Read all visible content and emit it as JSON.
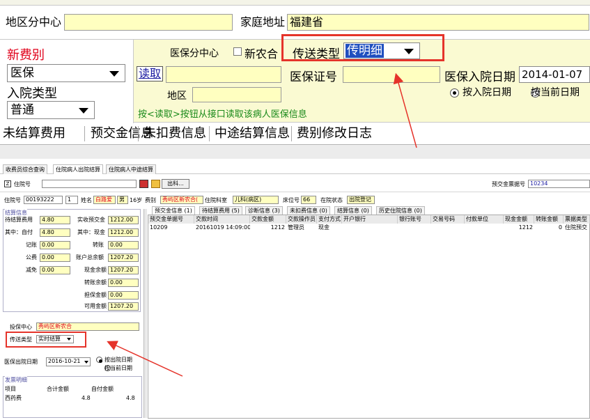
{
  "top": {
    "district_label": "地区分中心",
    "home_address_label": "家庭地址",
    "home_address_value": "福建省",
    "new_fee_type_label": "新费别",
    "fee_type_value": "医保",
    "admission_type_label": "入院类型",
    "admission_type_value": "普通",
    "insurance_center_label": "医保分中心",
    "new_rural_label": "新农合",
    "transfer_type_label": "传送类型",
    "transfer_type_value": "传明细",
    "read_card_button": "读取",
    "insurance_id_label": "医保证号",
    "admission_date_label": "医保入院日期",
    "admission_date_value": "2014-01-07",
    "area_label": "地区",
    "by_admission_date": "按入院日期",
    "by_current_date": "按当前日期",
    "read_hint": "按<读取>按钮从接口读取该病人医保信息",
    "tabs": [
      "未结算费用",
      "预交金信息",
      "未扣费信息",
      "中途结算信息",
      "费别修改日志"
    ]
  },
  "bottom": {
    "window_tabs": [
      "收费员综合查询",
      "住院病人出院结算",
      "住院病人中途结算"
    ],
    "inpatient_no_label": "住院号",
    "exit_button": "出科...",
    "prepay_receipt_label": "预交金票据号",
    "prepay_receipt_value": "10234",
    "info": {
      "inpatient_no_label": "住院号",
      "inpatient_no": "00193222",
      "visit_count": "1",
      "name_label": "姓名",
      "name": "白路爱",
      "gender": "男",
      "age": "16岁",
      "fee_label": "费别",
      "fee_value": "秀屿区新农合(",
      "dept_label": "住院科室",
      "dept_value": "儿科(病区)",
      "bed_label": "床位号",
      "bed_value": "66",
      "status_label": "在院状态",
      "status_value": "出院登记"
    },
    "settle": {
      "group_title": "结算信息",
      "pending_fee_label": "待结算费用",
      "pending_fee": "4.80",
      "received_prepay_label": "实收预交金",
      "received_prepay": "1212.00",
      "self_pay_label": "其中：自付",
      "self_pay": "4.80",
      "cash_label": "其中：现金",
      "cash": "1212.00",
      "account_label": "记账",
      "account": "0.00",
      "transfer_label": "转账",
      "transfer": "0.00",
      "public_label": "公费",
      "public": "0.00",
      "total_balance_label": "账户总余额",
      "total_balance": "1207.20",
      "reduce_label": "减免",
      "reduce": "0.00",
      "cash_balance_label": "现金余额",
      "cash_balance": "1207.20",
      "transfer_balance_label": "转账余额",
      "transfer_balance": "0.00",
      "guarantee_label": "担保金额",
      "guarantee": "0.00",
      "available_label": "可用金额",
      "available": "1207.20"
    },
    "insure_center_label": "投保中心",
    "insure_center_value": "秀屿区新农合",
    "transfer_type_label": "传送类型",
    "transfer_type_value": "实时结算",
    "discharge_date_label": "医保出院日期",
    "discharge_date_value": "2016-10-21",
    "by_discharge_date": "按出院日期",
    "by_current_date": "按当前日期",
    "invoice": {
      "group_title": "发票明细",
      "columns": [
        "项目",
        "合计金额",
        "自付金额"
      ],
      "rows": [
        [
          "西药费",
          "4.8",
          "4.8"
        ]
      ]
    },
    "grid_tabs": [
      "预交金信息 (1)",
      "待结算费用 (5)",
      "诊断信息 (3)",
      "未扣费信息 (0)",
      "结算信息 (0)",
      "历史住院信息 (0)"
    ],
    "grid_columns": [
      "预交金单据号",
      "交款时间",
      "交款金额",
      "交款操作员",
      "支付方式",
      "开户银行",
      "银行账号",
      "交易号码",
      "付款单位",
      "现金金额",
      "转账金额",
      "票据类型"
    ],
    "grid_rows": [
      [
        "10209",
        "20161019 14:09:00",
        "1212",
        "管理员",
        "现金",
        "",
        "",
        "",
        "",
        "1212",
        "0",
        "住院预交"
      ]
    ]
  },
  "colors": {
    "highlight_box": "#e5332a",
    "arrow": "#e5332a",
    "yellow_field": "#ffffc0",
    "panel_bg": "#fafad2"
  }
}
